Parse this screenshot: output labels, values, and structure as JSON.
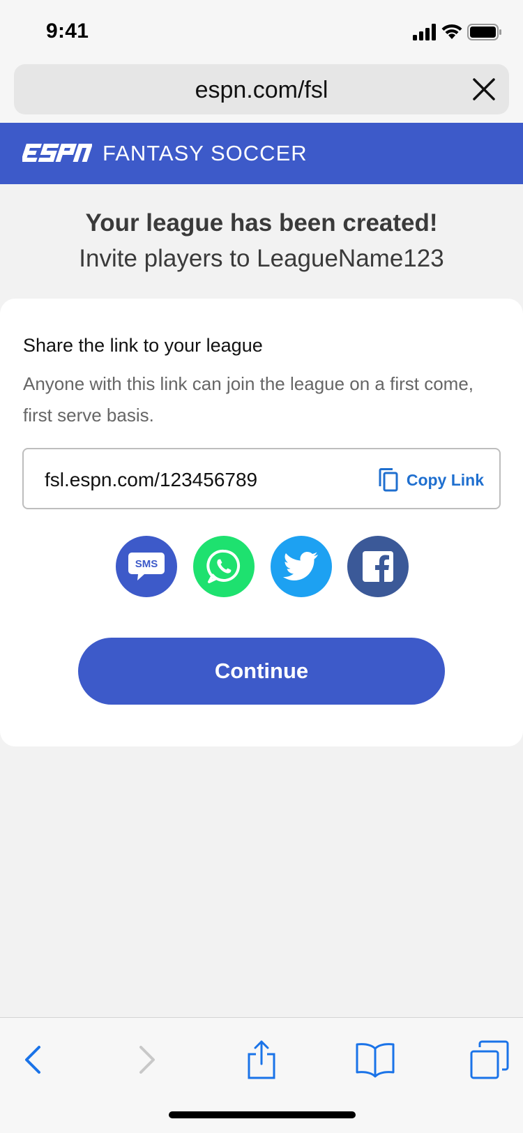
{
  "status_bar": {
    "time": "9:41"
  },
  "browser": {
    "url": "espn.com/fsl"
  },
  "app": {
    "logo_text": "ESPN",
    "title": "FANTASY SOCCER"
  },
  "page": {
    "heading": "Your league has been created!",
    "subheading": "Invite players to LeagueName123"
  },
  "share_card": {
    "title": "Share the link to your league",
    "description": "Anyone with this link can join the league on a first come, first serve basis.",
    "link_value": "fsl.espn.com/123456789",
    "copy_label": "Copy Link",
    "share_buttons": [
      {
        "name": "sms",
        "label": "SMS",
        "color": "#3d5ac9"
      },
      {
        "name": "whatsapp",
        "color": "#1ee16f"
      },
      {
        "name": "twitter",
        "color": "#1da1f2"
      },
      {
        "name": "facebook",
        "color": "#3b5998"
      }
    ],
    "continue_label": "Continue"
  },
  "colors": {
    "brand_blue": "#3d5ac9",
    "link_blue": "#1f6fcf",
    "ios_blue": "#1a73e8"
  },
  "toolbar": {
    "icons": [
      "back-icon",
      "forward-icon",
      "share-icon",
      "bookmarks-icon",
      "tabs-icon"
    ]
  }
}
